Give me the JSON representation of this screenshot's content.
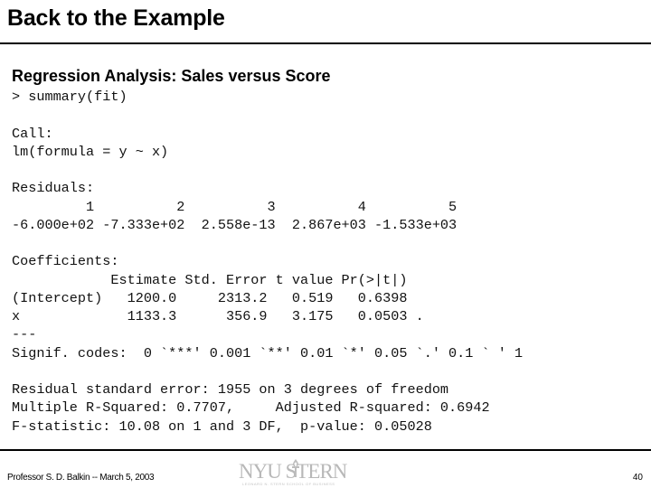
{
  "slide": {
    "title": "Back to the Example",
    "subtitle": "Regression Analysis: Sales versus Score"
  },
  "console": {
    "lines": [
      "> summary(fit)",
      "",
      "Call:",
      "lm(formula = y ~ x)",
      "",
      "Residuals:",
      "         1          2          3          4          5",
      "-6.000e+02 -7.333e+02  2.558e-13  2.867e+03 -1.533e+03",
      "",
      "Coefficients:",
      "            Estimate Std. Error t value Pr(>|t|)",
      "(Intercept)   1200.0     2313.2   0.519   0.6398",
      "x             1133.3      356.9   3.175   0.0503 .",
      "---",
      "Signif. codes:  0 `***' 0.001 `**' 0.01 `*' 0.05 `.' 0.1 ` ' 1",
      "",
      "Residual standard error: 1955 on 3 degrees of freedom",
      "Multiple R-Squared: 0.7707,     Adjusted R-squared: 0.6942",
      "F-statistic: 10.08 on 1 and 3 DF,  p-value: 0.05028"
    ]
  },
  "footer": {
    "author_date": "Professor S. D. Balkin -- March 5, 2003",
    "logo_text": "NYU STERN",
    "logo_tagline": "LEONARD N. STERN SCHOOL OF BUSINESS",
    "page_number": "40"
  }
}
